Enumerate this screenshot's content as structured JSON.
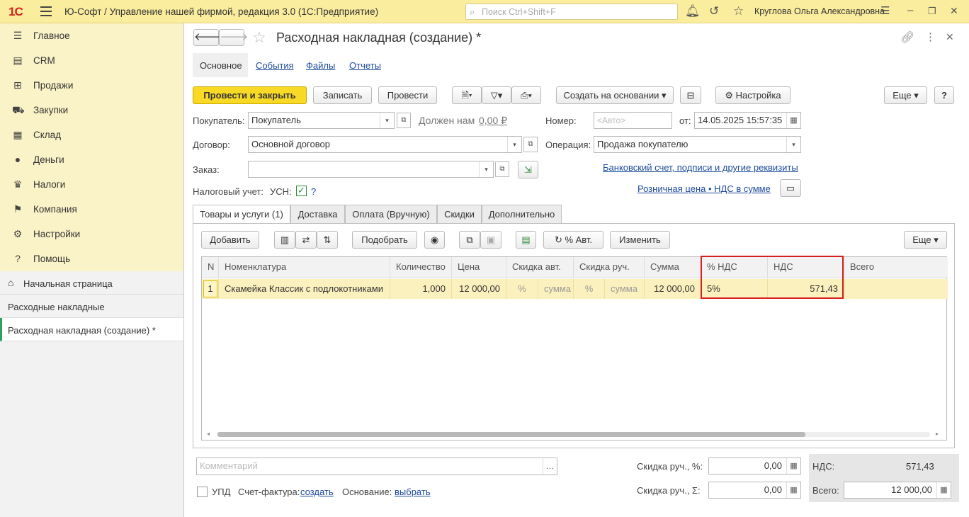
{
  "topbar": {
    "logo": "1С",
    "title": "Ю-Софт / Управление нашей фирмой, редакция 3.0  (1С:Предприятие)",
    "search_placeholder": "Поиск Ctrl+Shift+F",
    "user": "Круглова Ольга Александровна"
  },
  "sidebar": {
    "items": [
      {
        "label": "Главное",
        "icon": "menu-icon"
      },
      {
        "label": "CRM",
        "icon": "crm-icon"
      },
      {
        "label": "Продажи",
        "icon": "basket-icon"
      },
      {
        "label": "Закупки",
        "icon": "truck-icon"
      },
      {
        "label": "Склад",
        "icon": "warehouse-icon"
      },
      {
        "label": "Деньги",
        "icon": "coin-icon"
      },
      {
        "label": "Налоги",
        "icon": "emblem-icon"
      },
      {
        "label": "Компания",
        "icon": "flag-icon"
      },
      {
        "label": "Настройки",
        "icon": "gear-icon"
      },
      {
        "label": "Помощь",
        "icon": "help-icon"
      }
    ],
    "home": "Начальная страница",
    "open_windows": [
      "Расходные накладные",
      "Расходная накладная (создание) *"
    ]
  },
  "doc": {
    "title": "Расходная накладная (создание) *",
    "subtabs": [
      "Основное",
      "События",
      "Файлы",
      "Отчеты"
    ],
    "toolbar": {
      "post_close": "Провести и закрыть",
      "save": "Записать",
      "post": "Провести",
      "create_based": "Создать на основании",
      "settings": "Настройка",
      "more": "Еще",
      "help": "?"
    },
    "buyer_label": "Покупатель:",
    "buyer_value": "Покупатель",
    "owes_label": "Должен нам",
    "owes_value": "0,00 ₽",
    "number_label": "Номер:",
    "number_placeholder": "<Авто>",
    "date_label": "от:",
    "date_value": "14.05.2025 15:57:35",
    "contract_label": "Договор:",
    "contract_value": "Основной договор",
    "operation_label": "Операция:",
    "operation_value": "Продажа покупателю",
    "order_label": "Заказ:",
    "order_value": "",
    "bank_link": "Банковский счет, подписи и другие реквизиты",
    "tax_label": "Налоговый учет:",
    "tax_value": "УСН:",
    "tax_help": "?",
    "price_link": "Розничная цена • НДС в сумме"
  },
  "tabs": [
    "Товары и услуги (1)",
    "Доставка",
    "Оплата (Вручную)",
    "Скидки",
    "Дополнительно"
  ],
  "grid_toolbar": {
    "add": "Добавить",
    "pick": "Подобрать",
    "auto_pct": "% Авт.",
    "change": "Изменить",
    "more": "Еще"
  },
  "grid": {
    "columns": [
      "N",
      "Номенклатура",
      "Количество",
      "Цена",
      "Скидка авт.",
      "Скидка руч.",
      "Сумма",
      "% НДС",
      "НДС",
      "Всего"
    ],
    "rows": [
      {
        "n": "1",
        "name": "Скамейка Классик с подлокотниками",
        "qty": "1,000",
        "price": "12 000,00",
        "disc_auto_pct": "%",
        "disc_auto_sum": "сумма",
        "disc_man_pct": "%",
        "disc_man_sum": "сумма",
        "sum": "12 000,00",
        "vat_rate": "5%",
        "vat": "571,43",
        "total": ""
      }
    ]
  },
  "footer": {
    "comment_placeholder": "Комментарий",
    "upd": "УПД",
    "invoice_label": "Счет-фактура:",
    "invoice_link": "создать",
    "basis_label": "Основание:",
    "basis_link": "выбрать",
    "disc_pct_label": "Скидка руч., %:",
    "disc_pct_value": "0,00",
    "disc_sum_label": "Скидка руч., Σ:",
    "disc_sum_value": "0,00",
    "vat_label": "НДС:",
    "vat_value": "571,43",
    "total_label": "Всего:",
    "total_value": "12 000,00"
  },
  "colors": {
    "accent_yellow": "#f7d926",
    "topbar": "#fbed9e",
    "sidebar": "#fbf3c8",
    "highlight_border": "#d81e1e",
    "row_selected": "#fbf1bf"
  }
}
